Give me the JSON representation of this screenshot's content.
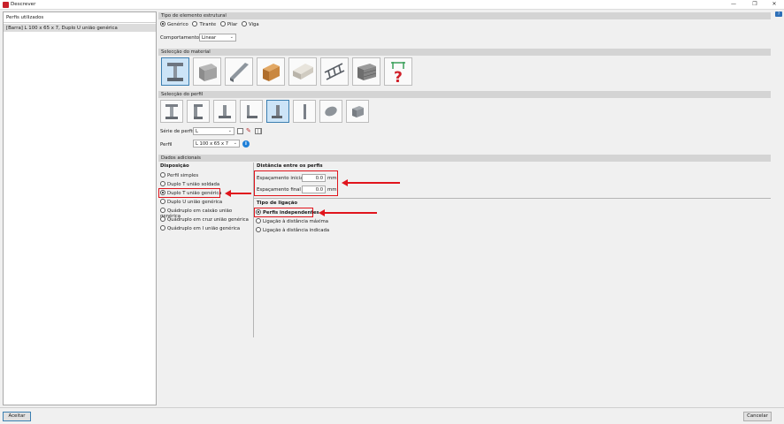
{
  "window": {
    "title": "Descrever",
    "minimize": "—",
    "maximize": "❐",
    "close": "✕",
    "help": "?"
  },
  "left_panel": {
    "header": "Perfis utilizados",
    "items": [
      "[Barra] L 100 x 65 x 7, Duplo U união genérica"
    ]
  },
  "element_type": {
    "header": "Tipo de elemento estrutural",
    "options": [
      "Genérico",
      "Tirante",
      "Pilar",
      "Viga"
    ],
    "selected": "Genérico",
    "behaviour_label": "Comportamento",
    "behaviour_value": "Linear"
  },
  "material": {
    "header": "Selecção do material",
    "items": [
      "steel-i-beam-icon",
      "concrete-beam-icon",
      "cold-formed-steel-icon",
      "timber-beam-icon",
      "aluminium-icon",
      "steel-truss-icon",
      "masonry-icon",
      "generic-material-icon"
    ],
    "selected_index": 0
  },
  "profile": {
    "header": "Selecção do perfil",
    "items": [
      "i-profile-icon",
      "c-profile-icon",
      "t-profile-icon",
      "l-profile-icon",
      "angle-profile-icon",
      "plate-profile-icon",
      "round-tube-icon",
      "rect-tube-icon"
    ],
    "selected_index": 4,
    "series_label": "Série de perfis",
    "series_value": "L",
    "profile_label": "Perfil",
    "profile_value": "L 100 x 65 x 7"
  },
  "additional": {
    "header": "Dados adicionais",
    "disposition_label": "Disposição",
    "dispositions": [
      "Perfil simples",
      "Duplo T união soldada",
      "Duplo T união genérica",
      "Duplo U união genérica",
      "Quádruplo em caixão união genérica",
      "Quádruplo em cruz união genérica",
      "Quádruplo em I união genérica"
    ],
    "disposition_selected": 2,
    "distance_label": "Distância entre os perfis",
    "initial_label": "Espaçamento inicial",
    "initial_value": "0.0",
    "final_label": "Espaçamento final",
    "final_value": "0.0",
    "unit": "mm",
    "connection_label": "Tipo de ligação",
    "connections": [
      "Perfis independentes",
      "Ligação à distância máxima",
      "Ligação à distância indicada"
    ],
    "connection_selected": 0
  },
  "buttons": {
    "accept": "Aceitar",
    "cancel": "Cancelar"
  },
  "colors": {
    "accent": "#e0141c",
    "selection": "#cce4f7"
  }
}
